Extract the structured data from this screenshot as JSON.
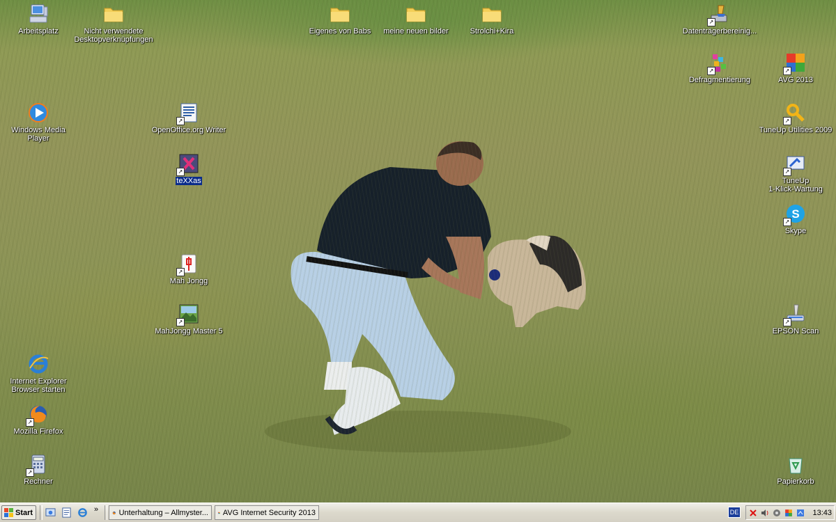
{
  "desktop": {
    "icons": [
      {
        "key": "arbeitsplatz",
        "label": "Arbeitsplatz",
        "icon": "computer-icon",
        "shortcut": false
      },
      {
        "key": "nicht-verwendete",
        "label": "Nicht verwendete\nDesktopverknüpfungen",
        "icon": "folder-icon",
        "shortcut": false
      },
      {
        "key": "eigenes-von-babs",
        "label": "Eigenes von Babs",
        "icon": "folder-icon",
        "shortcut": false
      },
      {
        "key": "meine-neuen-bilder",
        "label": "meine neuen bilder",
        "icon": "folder-icon",
        "shortcut": false
      },
      {
        "key": "strolchi-kira",
        "label": "Strolchi+Kira",
        "icon": "folder-icon",
        "shortcut": false
      },
      {
        "key": "datentraeger",
        "label": "Datenträgerbereinig...",
        "icon": "disk-cleanup-icon",
        "shortcut": true
      },
      {
        "key": "defragmentierung",
        "label": "Defragmentierung",
        "icon": "defrag-icon",
        "shortcut": true
      },
      {
        "key": "avg-2013",
        "label": "AVG 2013",
        "icon": "avg-icon",
        "shortcut": true
      },
      {
        "key": "windows-media-player",
        "label": "Windows Media Player",
        "icon": "media-player-icon",
        "shortcut": false
      },
      {
        "key": "openoffice-writer",
        "label": "OpenOffice.org Writer",
        "icon": "writer-icon",
        "shortcut": true
      },
      {
        "key": "tuneup-utilities",
        "label": "TuneUp Utilities 2009",
        "icon": "tuneup-icon",
        "shortcut": true
      },
      {
        "key": "texxas",
        "label": "teXXas",
        "icon": "texxas-icon",
        "shortcut": true,
        "selected": true
      },
      {
        "key": "tuneup-1klick",
        "label": "TuneUp\n1-Klick-Wartung",
        "icon": "tuneup-1click-icon",
        "shortcut": true
      },
      {
        "key": "skype",
        "label": "Skype",
        "icon": "skype-icon",
        "shortcut": true
      },
      {
        "key": "mah-jongg",
        "label": "Mah Jongg",
        "icon": "mahjong-icon",
        "shortcut": true
      },
      {
        "key": "mahjongg-master",
        "label": "MahJongg Master 5",
        "icon": "mahjongg-master-icon",
        "shortcut": true
      },
      {
        "key": "epson-scan",
        "label": "EPSON Scan",
        "icon": "scanner-icon",
        "shortcut": true
      },
      {
        "key": "internet-explorer",
        "label": "Internet Explorer\nBrowser starten",
        "icon": "internet-explorer-icon",
        "shortcut": false
      },
      {
        "key": "firefox",
        "label": "Mozilla Firefox",
        "icon": "firefox-icon",
        "shortcut": true
      },
      {
        "key": "rechner",
        "label": "Rechner",
        "icon": "calculator-icon",
        "shortcut": true
      },
      {
        "key": "papierkorb",
        "label": "Papierkorb",
        "icon": "recycle-bin-icon",
        "shortcut": false
      }
    ]
  },
  "taskbar": {
    "start_label": "Start",
    "quicklaunch_more": "»",
    "tasks": [
      {
        "label": "Unterhaltung – Allmyster...",
        "icon": "firefox-icon"
      },
      {
        "label": "AVG Internet Security 2013",
        "icon": "avg-icon"
      }
    ],
    "language": "DE",
    "clock": "13:43"
  }
}
